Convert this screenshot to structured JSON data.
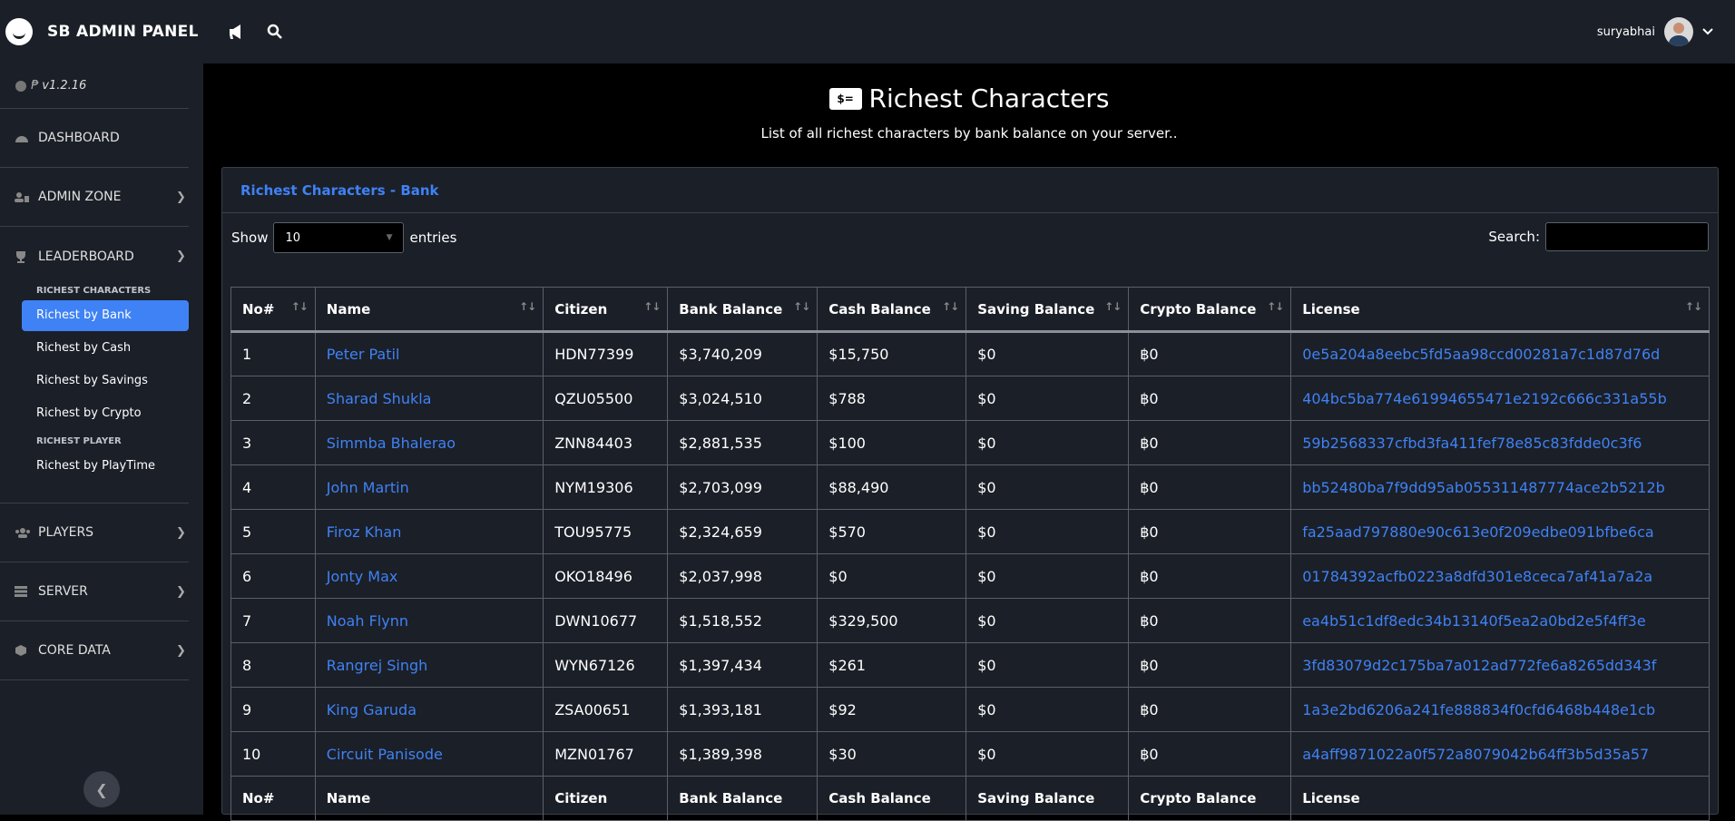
{
  "app": {
    "title": "SB ADMIN PANEL",
    "user_name": "suryabhai",
    "version": "v1.2.16"
  },
  "sidebar": {
    "items": [
      {
        "label": "DASHBOARD",
        "icon": "dashboard-icon"
      },
      {
        "label": "ADMIN ZONE",
        "icon": "user-shield-icon"
      },
      {
        "label": "LEADERBOARD",
        "icon": "trophy-icon"
      },
      {
        "label": "PLAYERS",
        "icon": "users-icon"
      },
      {
        "label": "SERVER",
        "icon": "server-icon"
      },
      {
        "label": "CORE DATA",
        "icon": "box-icon"
      }
    ],
    "section_characters": "RICHEST CHARACTERS",
    "section_player": "RICHEST PLAYER",
    "subitems": [
      {
        "label": "Richest by Bank",
        "active": true
      },
      {
        "label": "Richest by Cash"
      },
      {
        "label": "Richest by Savings"
      },
      {
        "label": "Richest by Crypto"
      },
      {
        "label": "Richest by PlayTime"
      }
    ]
  },
  "page": {
    "title": "Richest Characters",
    "subtitle": "List of all richest characters by bank balance on your server..",
    "card_title": "Richest Characters - Bank",
    "show_label": "Show",
    "entries_value": "10",
    "entries_label": "entries",
    "search_label": "Search:"
  },
  "table": {
    "headers": [
      "No#",
      "Name",
      "Citizen",
      "Bank Balance",
      "Cash Balance",
      "Saving Balance",
      "Crypto Balance",
      "License"
    ],
    "rows": [
      [
        "1",
        "Peter Patil",
        "HDN77399",
        "$3,740,209",
        "$15,750",
        "$0",
        "฿0",
        "0e5a204a8eebc5fd5aa98ccd00281a7c1d87d76d"
      ],
      [
        "2",
        "Sharad Shukla",
        "QZU05500",
        "$3,024,510",
        "$788",
        "$0",
        "฿0",
        "404bc5ba774e61994655471e2192c666c331a55b"
      ],
      [
        "3",
        "Simmba Bhalerao",
        "ZNN84403",
        "$2,881,535",
        "$100",
        "$0",
        "฿0",
        "59b2568337cfbd3fa411fef78e85c83fdde0c3f6"
      ],
      [
        "4",
        "John Martin",
        "NYM19306",
        "$2,703,099",
        "$88,490",
        "$0",
        "฿0",
        "bb52480ba7f9dd95ab055311487774ace2b5212b"
      ],
      [
        "5",
        "Firoz Khan",
        "TOU95775",
        "$2,324,659",
        "$570",
        "$0",
        "฿0",
        "fa25aad797880e90c613e0f209edbe091bfbe6ca"
      ],
      [
        "6",
        "Jonty Max",
        "OKO18496",
        "$2,037,998",
        "$0",
        "$0",
        "฿0",
        "01784392acfb0223a8dfd301e8ceca7af41a7a2a"
      ],
      [
        "7",
        "Noah Flynn",
        "DWN10677",
        "$1,518,552",
        "$329,500",
        "$0",
        "฿0",
        "ea4b51c1df8edc34b13140f5ea2a0bd2e5f4ff3e"
      ],
      [
        "8",
        "Rangrej Singh",
        "WYN67126",
        "$1,397,434",
        "$261",
        "$0",
        "฿0",
        "3fd83079d2c175ba7a012ad772fe6a8265dd343f"
      ],
      [
        "9",
        "King Garuda",
        "ZSA00651",
        "$1,393,181",
        "$92",
        "$0",
        "฿0",
        "1a3e2bd6206a241fe888834f0cfd6468b448e1cb"
      ],
      [
        "10",
        "Circuit Panisode",
        "MZN01767",
        "$1,389,398",
        "$30",
        "$0",
        "฿0",
        "a4aff9871022a0f572a8079042b64ff3b5d35a57"
      ]
    ]
  },
  "colors": {
    "accent": "#3f82f5",
    "panel": "#1b1f27",
    "background": "#000000"
  }
}
